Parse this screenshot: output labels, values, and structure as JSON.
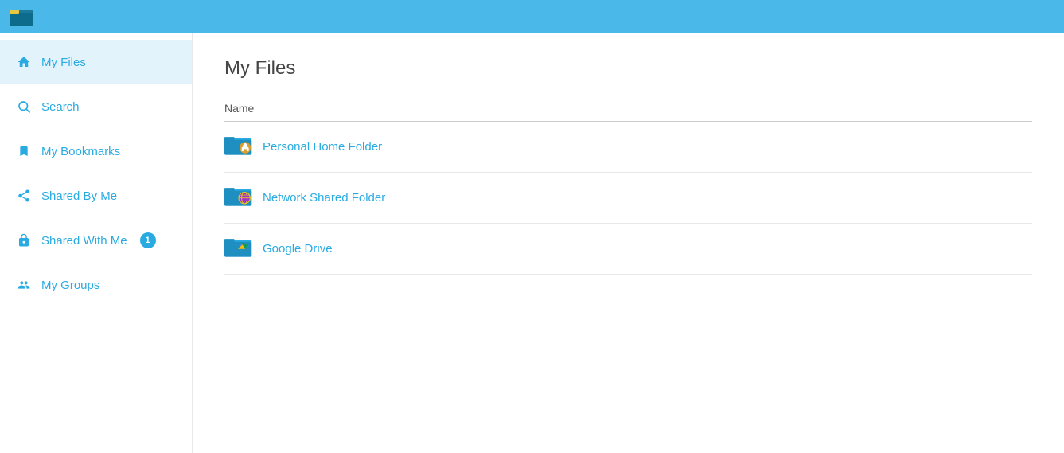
{
  "topbar": {
    "logo_alt": "App Logo"
  },
  "sidebar": {
    "items": [
      {
        "id": "my-files",
        "label": "My Files",
        "icon": "home",
        "active": true,
        "badge": null
      },
      {
        "id": "search",
        "label": "Search",
        "icon": "search",
        "active": false,
        "badge": null
      },
      {
        "id": "my-bookmarks",
        "label": "My Bookmarks",
        "icon": "bookmark",
        "active": false,
        "badge": null
      },
      {
        "id": "shared-by-me",
        "label": "Shared By Me",
        "icon": "share",
        "active": false,
        "badge": null
      },
      {
        "id": "shared-with-me",
        "label": "Shared With Me",
        "icon": "share-alt",
        "active": false,
        "badge": "1"
      },
      {
        "id": "my-groups",
        "label": "My Groups",
        "icon": "users",
        "active": false,
        "badge": null
      }
    ]
  },
  "content": {
    "page_title": "My Files",
    "table_header": "Name",
    "files": [
      {
        "id": "personal-home",
        "name": "Personal Home Folder",
        "icon_type": "home-folder"
      },
      {
        "id": "network-shared",
        "name": "Network Shared Folder",
        "icon_type": "network-folder"
      },
      {
        "id": "google-drive",
        "name": "Google Drive",
        "icon_type": "google-drive-folder"
      }
    ]
  },
  "colors": {
    "accent": "#29abe2",
    "topbar": "#4ab8e8",
    "active_bg": "#e3f3fc",
    "text_dark": "#444",
    "text_gray": "#555",
    "border": "#e8e8e8"
  }
}
